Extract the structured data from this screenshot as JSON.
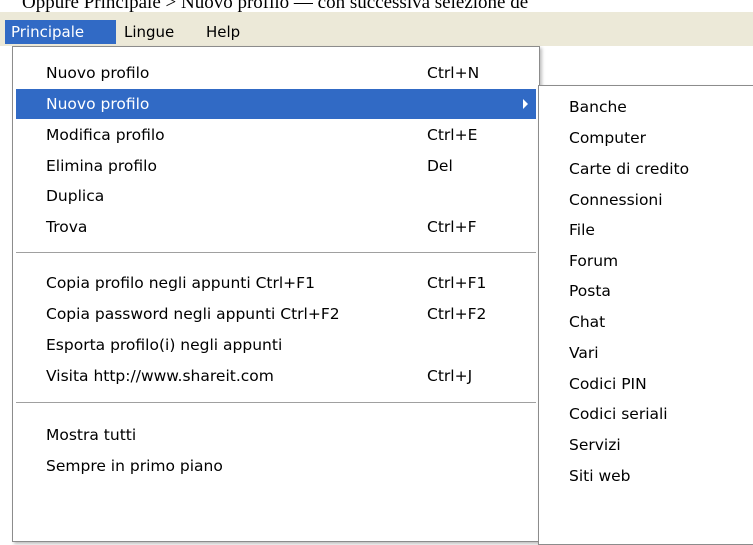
{
  "caption": "Oppure Principale > Nuovo profilo — con successiva selezione de",
  "menubar": {
    "items": [
      "Principale",
      "Lingue",
      "Help"
    ]
  },
  "main_menu": {
    "items": [
      {
        "label": "Nuovo profilo",
        "shortcut": "Ctrl+N"
      },
      {
        "label": "Nuovo profilo",
        "shortcut": ""
      },
      {
        "label": "Modifica profilo",
        "shortcut": "Ctrl+E"
      },
      {
        "label": "Elimina profilo",
        "shortcut": "Del"
      },
      {
        "label": "Duplica",
        "shortcut": ""
      },
      {
        "label": "Trova",
        "shortcut": "Ctrl+F"
      },
      {
        "label": "Copia profilo negli appunti Ctrl+F1",
        "shortcut": "Ctrl+F1"
      },
      {
        "label": "Copia password negli appunti Ctrl+F2",
        "shortcut": "Ctrl+F2"
      },
      {
        "label": "Esporta profilo(i) negli appunti",
        "shortcut": ""
      },
      {
        "label": "Visita http://www.shareit.com",
        "shortcut": "Ctrl+J"
      },
      {
        "label": "Mostra tutti",
        "shortcut": ""
      },
      {
        "label": "Sempre in primo piano",
        "shortcut": ""
      }
    ]
  },
  "submenu": {
    "items": [
      "Banche",
      "Computer",
      "Carte di credito",
      "Connessioni",
      "File",
      "Forum",
      "Posta",
      "Chat",
      "Vari",
      "Codici PIN",
      "Codici seriali",
      "Servizi",
      "Siti web"
    ]
  },
  "colors": {
    "highlight": "#316ac5",
    "menubar_bg": "#ece9d8",
    "menu_bg": "#ffffff"
  },
  "icons": {
    "submenu_arrow": "chevron-right-icon"
  }
}
